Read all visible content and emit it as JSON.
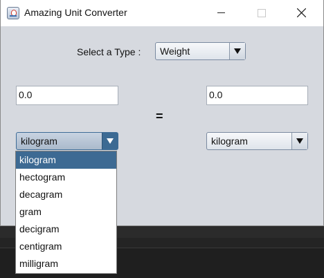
{
  "window": {
    "title": "Amazing Unit Converter",
    "icon": "java-app-icon"
  },
  "type_selector": {
    "label": "Select a Type :",
    "value": "Weight"
  },
  "left": {
    "input_value": "0.0",
    "unit": "kilogram"
  },
  "right": {
    "input_value": "0.0",
    "unit": "kilogram"
  },
  "equals": "=",
  "dropdown": {
    "items": [
      "kilogram",
      "hectogram",
      "decagram",
      "gram",
      "decigram",
      "centigram",
      "milligram"
    ],
    "selected_index": 0
  },
  "colors": {
    "selection": "#3d6a93",
    "window_bg": "#d6d9df"
  }
}
